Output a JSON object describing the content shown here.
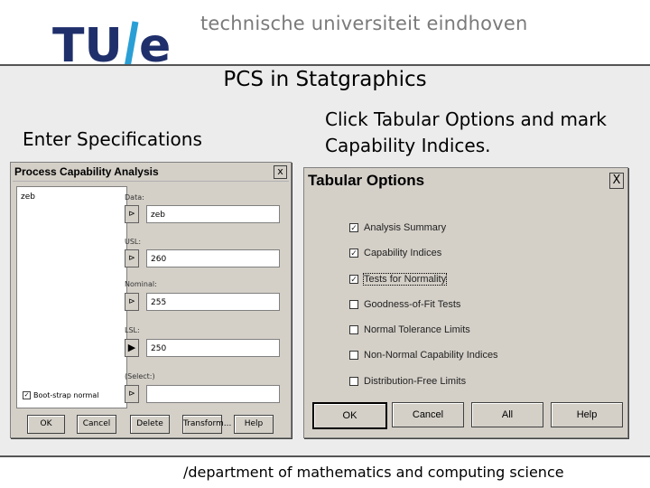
{
  "header": {
    "logo_text": "TU/e",
    "university": "technische universiteit eindhoven"
  },
  "slide": {
    "title": "PCS in Statgraphics",
    "left_caption": "Enter Specifications",
    "right_caption_line1": "Click Tabular Options and mark",
    "right_caption_line2": "Capability Indices."
  },
  "pca_dialog": {
    "title": "Process Capability Analysis",
    "close": "x",
    "variables": [
      "zeb"
    ],
    "fields": [
      {
        "label": "Data:",
        "value": "zeb",
        "arrow": "⊳"
      },
      {
        "label": "USL:",
        "value": "260",
        "arrow": "⊳"
      },
      {
        "label": "Nominal:",
        "value": "255",
        "arrow": "⊳"
      },
      {
        "label": "LSL:",
        "value": "250",
        "arrow": "▶"
      },
      {
        "label": "(Select:)",
        "value": "",
        "arrow": "⊳"
      }
    ],
    "checkbox": {
      "label": "Boot-strap normal",
      "checked": true
    },
    "buttons": [
      "OK",
      "Cancel",
      "Delete",
      "Transform...",
      "Help"
    ]
  },
  "tabular_dialog": {
    "title": "Tabular Options",
    "close": "X",
    "options": [
      {
        "label": "Analysis Summary",
        "checked": true
      },
      {
        "label": "Capability Indices",
        "checked": true
      },
      {
        "label": "Tests for Normality",
        "checked": true
      },
      {
        "label": "Goodness-of-Fit Tests",
        "checked": false
      },
      {
        "label": "Normal Tolerance Limits",
        "checked": false
      },
      {
        "label": "Non-Normal Capability Indices",
        "checked": false
      },
      {
        "label": "Distribution-Free Limits",
        "checked": false
      }
    ],
    "buttons": [
      "OK",
      "Cancel",
      "All",
      "Help"
    ]
  },
  "footer": {
    "text": "/department of mathematics and computing science"
  },
  "colors": {
    "logo_blue": "#1f2f6b",
    "logo_slash": "#2a9fd6",
    "dialog_gray": "#d4d0c8"
  }
}
